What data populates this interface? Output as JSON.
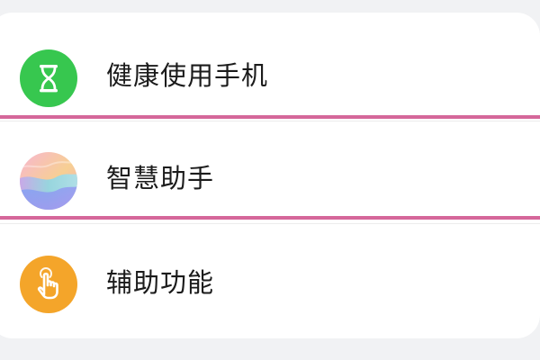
{
  "settings_list": {
    "items": [
      {
        "label": "健康使用手机",
        "icon": "hourglass-icon",
        "icon_color": "#37c74f"
      },
      {
        "label": "智慧助手",
        "icon": "smart-assistant-icon",
        "icon_colors": [
          "#f3a8c6",
          "#f6d08a",
          "#8fd8e6",
          "#8fa8f0"
        ]
      },
      {
        "label": "辅助功能",
        "icon": "hand-pointer-icon",
        "icon_color": "#f4a52a"
      }
    ]
  },
  "colors": {
    "background": "#f1f2f4",
    "card": "#ffffff",
    "highlight_line": "#d5679a",
    "text": "#1b1b1b"
  }
}
